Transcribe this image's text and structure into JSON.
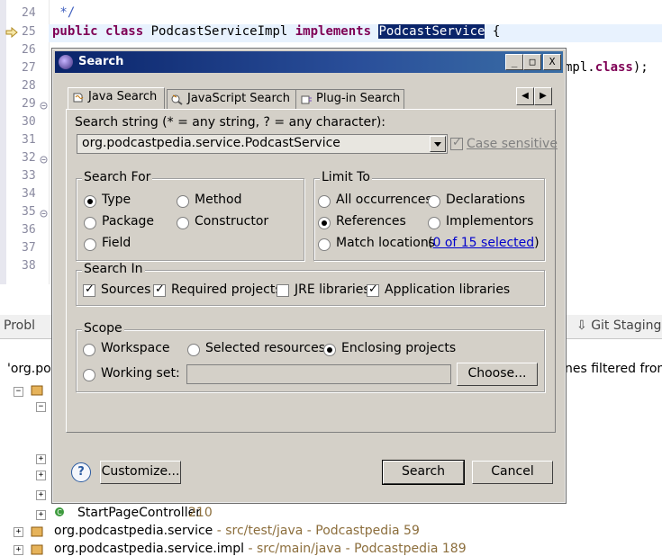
{
  "editor": {
    "lines": [
      {
        "num": "24",
        "code": " */",
        "type": "comment"
      },
      {
        "num": "25",
        "kw1": "public class",
        "mid": " PodcastServiceImpl ",
        "kw2": "implements",
        "sel": "PodcastService",
        "tail": " {"
      },
      {
        "num": "26",
        "code": ""
      },
      {
        "num": "27",
        "code": "mpl.class);"
      },
      {
        "num": "28",
        "code": ""
      },
      {
        "num": "29",
        "code": ""
      },
      {
        "num": "30",
        "code": ""
      },
      {
        "num": "31",
        "code": ""
      },
      {
        "num": "32",
        "code": ""
      },
      {
        "num": "33",
        "code": ""
      },
      {
        "num": "34",
        "code": ""
      },
      {
        "num": "35",
        "code": ""
      },
      {
        "num": "36",
        "code": ""
      },
      {
        "num": "37",
        "code": ""
      },
      {
        "num": "38",
        "code": ""
      }
    ]
  },
  "lowerview": {
    "problems_tab": "Probl",
    "git_tab": "Git Staging",
    "search_result_left": "'org.podc",
    "search_result_right": "nes filtered from vi",
    "tree": [
      {
        "label": "StartPageController",
        "count": "210"
      },
      {
        "label": "org.podcastpedia.service",
        "path": " - src/test/java - Podcastpedia",
        "count": "59"
      },
      {
        "label": "org.podcastpedia.service.impl",
        "path": " - src/main/java - Podcastpedia",
        "count": "189"
      }
    ]
  },
  "dialog": {
    "title": "Search",
    "window_buttons": {
      "minimize": "_",
      "maximize": "□",
      "close": "X"
    },
    "tabs": [
      {
        "label": "Java Search",
        "active": true
      },
      {
        "label": "JavaScript Search",
        "active": false
      },
      {
        "label": "Plug-in Search",
        "active": false
      }
    ],
    "search_string_label": "Search string (* = any string, ? = any character):",
    "search_string_value": "org.podcastpedia.service.PodcastService",
    "case_sensitive": "Case sensitive",
    "search_for": {
      "title": "Search For",
      "options": [
        "Type",
        "Method",
        "Package",
        "Constructor",
        "Field"
      ],
      "selected": "Type"
    },
    "limit_to": {
      "title": "Limit To",
      "options": [
        "All occurrences",
        "Declarations",
        "References",
        "Implementors",
        "Match locations"
      ],
      "selected": "References",
      "match_link": "0 of 15 selected",
      "match_open": "(",
      "match_close": ")"
    },
    "search_in": {
      "title": "Search In",
      "items": [
        {
          "label": "Sources",
          "checked": true
        },
        {
          "label": "Required projects",
          "checked": true
        },
        {
          "label": "JRE libraries",
          "checked": false
        },
        {
          "label": "Application libraries",
          "checked": true
        }
      ]
    },
    "scope": {
      "title": "Scope",
      "options": [
        "Workspace",
        "Selected resources",
        "Enclosing projects",
        "Working set:"
      ],
      "selected": "Enclosing projects",
      "choose_button": "Choose..."
    },
    "buttons": {
      "help": "?",
      "customize": "Customize...",
      "search": "Search",
      "cancel": "Cancel"
    }
  }
}
